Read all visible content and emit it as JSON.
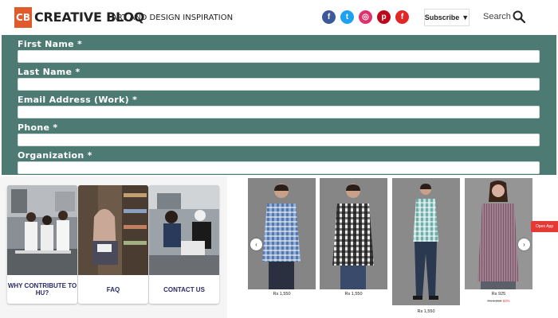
{
  "header": {
    "logo_mark": "CB",
    "logo_text": "CREATIVE BLOQ",
    "tagline": "ART AND DESIGN INSPIRATION",
    "subscribe_label": "Subscribe",
    "search_label": "Search",
    "social": [
      {
        "name": "facebook",
        "glyph": "f",
        "color": "#3b5998"
      },
      {
        "name": "twitter",
        "glyph": "t",
        "color": "#1da1f2"
      },
      {
        "name": "instagram",
        "glyph": "◎",
        "color": "#e1306c"
      },
      {
        "name": "pinterest",
        "glyph": "p",
        "color": "#bd081c"
      },
      {
        "name": "flipboard",
        "glyph": "f",
        "color": "#e12828"
      }
    ]
  },
  "form": {
    "fields": [
      {
        "label": "First Name *"
      },
      {
        "label": "Last Name *"
      },
      {
        "label": "Email Address (Work) *"
      },
      {
        "label": "Phone *"
      },
      {
        "label": "Organization *"
      }
    ]
  },
  "cards": [
    {
      "label": "WHY CONTRIBUTE TO HU?"
    },
    {
      "label": "FAQ"
    },
    {
      "label": "CONTACT US"
    }
  ],
  "products": [
    {
      "price": "Rs 1,550",
      "old_price": "",
      "discount": ""
    },
    {
      "price": "Rs 1,550",
      "old_price": "",
      "discount": ""
    },
    {
      "price": "Rs 1,550",
      "old_price": "",
      "discount": ""
    },
    {
      "price": "Rs 925",
      "old_price": "Rs 1,850",
      "discount": "50%"
    }
  ],
  "open_app_label": "Open App",
  "colors": {
    "form_bg": "#4e7a74",
    "logo_accent": "#e05a2b",
    "card_label": "#2a2a6a",
    "open_app": "#e53935"
  }
}
